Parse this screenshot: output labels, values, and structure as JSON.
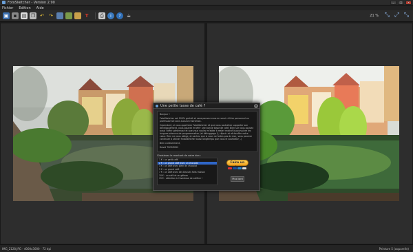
{
  "window": {
    "title": "FotoSketcher - Version 2.90"
  },
  "menu": {
    "items": [
      "Fichier",
      "Edition",
      "Aide"
    ]
  },
  "toolbar": {
    "zoom": "21 %"
  },
  "dialog": {
    "title": "Une petite tasse de café ?",
    "greeting": "Bonjour !",
    "paragraph1": "FotoSketcher est 100% gratuit et vous pouvez vous en servir à titre personnel ou professionnel sans aucune restriction.",
    "paragraph2": "Cependant, si vous appréciez FotoSketcher et que vous souhaitez supporter son développement, vous pouvez m'offrir une bonne tasse de café. Bien sûr vous pouvez aussi l'offrir généreuse et que vous voulez m'aider à rester motivé à poursuivre les longues séances de programmation (et débuggage !), réjouir et réchauffer votre cœur. Rien ne vous oblige, et sachez que si vous ne faites pas de don, vous pourrez continuer à utiliser FotoSketcher aussi longtemps que vous le souhaitez ;-)",
    "signoff": "Bien cordialement,",
    "author": "David THOMSON",
    "choose_label": "Choisissez le montant de votre don :",
    "options": [
      "1 € : un petit café",
      "2 € : un grand café avec un chocolat",
      "3 € : un café avec plein de chocolat",
      "5 € : un grand café",
      "7 € : un café avec des biscuits faits maison",
      "10 € : un café et un gâteau",
      "15 € : attention à l'overdose de caféine !"
    ],
    "selected_option": "2 € : un grand café avec un chocolat",
    "donate_label": "Faire un don",
    "later_label": "Plus tard"
  },
  "status": {
    "left": "IMG_2128.JPG - 4000x3000 - 72 dpi",
    "right": "Peinture 5 (aquarelle)"
  },
  "colors": {
    "accent": "#2f66c8",
    "donate": "#f0a020",
    "close": "#b03a2e"
  }
}
